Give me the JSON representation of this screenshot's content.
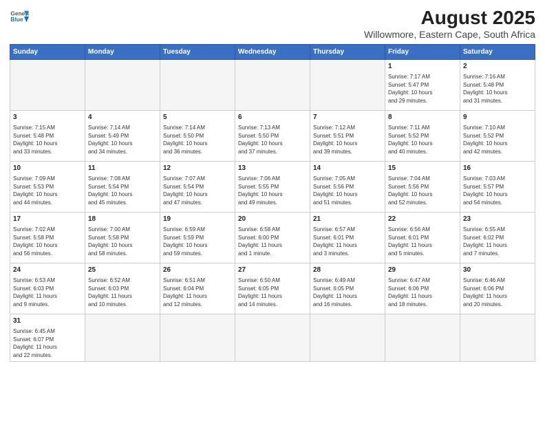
{
  "header": {
    "logo_general": "General",
    "logo_blue": "Blue",
    "title": "August 2025",
    "subtitle": "Willowmore, Eastern Cape, South Africa"
  },
  "days_of_week": [
    "Sunday",
    "Monday",
    "Tuesday",
    "Wednesday",
    "Thursday",
    "Friday",
    "Saturday"
  ],
  "weeks": [
    {
      "cells": [
        {
          "day": "",
          "info": ""
        },
        {
          "day": "",
          "info": ""
        },
        {
          "day": "",
          "info": ""
        },
        {
          "day": "",
          "info": ""
        },
        {
          "day": "",
          "info": ""
        },
        {
          "day": "1",
          "info": "Sunrise: 7:17 AM\nSunset: 5:47 PM\nDaylight: 10 hours\nand 29 minutes."
        },
        {
          "day": "2",
          "info": "Sunrise: 7:16 AM\nSunset: 5:48 PM\nDaylight: 10 hours\nand 31 minutes."
        }
      ]
    },
    {
      "cells": [
        {
          "day": "3",
          "info": "Sunrise: 7:15 AM\nSunset: 5:48 PM\nDaylight: 10 hours\nand 33 minutes."
        },
        {
          "day": "4",
          "info": "Sunrise: 7:14 AM\nSunset: 5:49 PM\nDaylight: 10 hours\nand 34 minutes."
        },
        {
          "day": "5",
          "info": "Sunrise: 7:14 AM\nSunset: 5:50 PM\nDaylight: 10 hours\nand 36 minutes."
        },
        {
          "day": "6",
          "info": "Sunrise: 7:13 AM\nSunset: 5:50 PM\nDaylight: 10 hours\nand 37 minutes."
        },
        {
          "day": "7",
          "info": "Sunrise: 7:12 AM\nSunset: 5:51 PM\nDaylight: 10 hours\nand 39 minutes."
        },
        {
          "day": "8",
          "info": "Sunrise: 7:11 AM\nSunset: 5:52 PM\nDaylight: 10 hours\nand 40 minutes."
        },
        {
          "day": "9",
          "info": "Sunrise: 7:10 AM\nSunset: 5:52 PM\nDaylight: 10 hours\nand 42 minutes."
        }
      ]
    },
    {
      "cells": [
        {
          "day": "10",
          "info": "Sunrise: 7:09 AM\nSunset: 5:53 PM\nDaylight: 10 hours\nand 44 minutes."
        },
        {
          "day": "11",
          "info": "Sunrise: 7:08 AM\nSunset: 5:54 PM\nDaylight: 10 hours\nand 45 minutes."
        },
        {
          "day": "12",
          "info": "Sunrise: 7:07 AM\nSunset: 5:54 PM\nDaylight: 10 hours\nand 47 minutes."
        },
        {
          "day": "13",
          "info": "Sunrise: 7:06 AM\nSunset: 5:55 PM\nDaylight: 10 hours\nand 49 minutes."
        },
        {
          "day": "14",
          "info": "Sunrise: 7:05 AM\nSunset: 5:56 PM\nDaylight: 10 hours\nand 51 minutes."
        },
        {
          "day": "15",
          "info": "Sunrise: 7:04 AM\nSunset: 5:56 PM\nDaylight: 10 hours\nand 52 minutes."
        },
        {
          "day": "16",
          "info": "Sunrise: 7:03 AM\nSunset: 5:57 PM\nDaylight: 10 hours\nand 54 minutes."
        }
      ]
    },
    {
      "cells": [
        {
          "day": "17",
          "info": "Sunrise: 7:02 AM\nSunset: 5:58 PM\nDaylight: 10 hours\nand 56 minutes."
        },
        {
          "day": "18",
          "info": "Sunrise: 7:00 AM\nSunset: 5:58 PM\nDaylight: 10 hours\nand 58 minutes."
        },
        {
          "day": "19",
          "info": "Sunrise: 6:59 AM\nSunset: 5:59 PM\nDaylight: 10 hours\nand 59 minutes."
        },
        {
          "day": "20",
          "info": "Sunrise: 6:58 AM\nSunset: 6:00 PM\nDaylight: 11 hours\nand 1 minute."
        },
        {
          "day": "21",
          "info": "Sunrise: 6:57 AM\nSunset: 6:01 PM\nDaylight: 11 hours\nand 3 minutes."
        },
        {
          "day": "22",
          "info": "Sunrise: 6:56 AM\nSunset: 6:01 PM\nDaylight: 11 hours\nand 5 minutes."
        },
        {
          "day": "23",
          "info": "Sunrise: 6:55 AM\nSunset: 6:02 PM\nDaylight: 11 hours\nand 7 minutes."
        }
      ]
    },
    {
      "cells": [
        {
          "day": "24",
          "info": "Sunrise: 6:53 AM\nSunset: 6:03 PM\nDaylight: 11 hours\nand 9 minutes."
        },
        {
          "day": "25",
          "info": "Sunrise: 6:52 AM\nSunset: 6:03 PM\nDaylight: 11 hours\nand 10 minutes."
        },
        {
          "day": "26",
          "info": "Sunrise: 6:51 AM\nSunset: 6:04 PM\nDaylight: 11 hours\nand 12 minutes."
        },
        {
          "day": "27",
          "info": "Sunrise: 6:50 AM\nSunset: 6:05 PM\nDaylight: 11 hours\nand 14 minutes."
        },
        {
          "day": "28",
          "info": "Sunrise: 6:49 AM\nSunset: 6:05 PM\nDaylight: 11 hours\nand 16 minutes."
        },
        {
          "day": "29",
          "info": "Sunrise: 6:47 AM\nSunset: 6:06 PM\nDaylight: 11 hours\nand 18 minutes."
        },
        {
          "day": "30",
          "info": "Sunrise: 6:46 AM\nSunset: 6:06 PM\nDaylight: 11 hours\nand 20 minutes."
        }
      ]
    },
    {
      "cells": [
        {
          "day": "31",
          "info": "Sunrise: 6:45 AM\nSunset: 6:07 PM\nDaylight: 11 hours\nand 22 minutes."
        },
        {
          "day": "",
          "info": ""
        },
        {
          "day": "",
          "info": ""
        },
        {
          "day": "",
          "info": ""
        },
        {
          "day": "",
          "info": ""
        },
        {
          "day": "",
          "info": ""
        },
        {
          "day": "",
          "info": ""
        }
      ]
    }
  ]
}
